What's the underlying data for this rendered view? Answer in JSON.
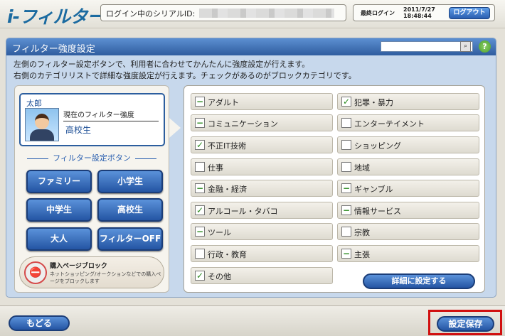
{
  "header": {
    "logo": "i-フィルター",
    "serial_label": "ログイン中のシリアルID:",
    "last_login_label": "最終ログイン",
    "last_login_date": "2011/7/27",
    "last_login_time": "18:48:44",
    "logout_label": "ログアウト"
  },
  "panel": {
    "title": "フィルター強度設定",
    "description_line1": "左側のフィルター設定ボタンで、利用者に合わせてかんたんに強度設定が行えます。",
    "description_line2": "右側のカテゴリリストで詳細な強度設定が行えます。チェックがあるのがブロックカテゴリです。"
  },
  "user": {
    "name": "太郎",
    "strength_label": "現在のフィルター強度",
    "strength_value": "高校生"
  },
  "presets": {
    "heading": "フィルター設定ボタン",
    "buttons": [
      "ファミリー",
      "小学生",
      "中学生",
      "高校生",
      "大人",
      "フィルターOFF"
    ]
  },
  "purchase_block": {
    "title": "購入ページブロック",
    "description": "ネットショッピング/オークションなどでの購入ページをブロックします"
  },
  "categories": [
    {
      "label": "アダルト",
      "state": "partial"
    },
    {
      "label": "犯罪・暴力",
      "state": "checked"
    },
    {
      "label": "コミュニケーション",
      "state": "partial"
    },
    {
      "label": "エンターテイメント",
      "state": "unchecked"
    },
    {
      "label": "不正IT技術",
      "state": "checked"
    },
    {
      "label": "ショッピング",
      "state": "unchecked"
    },
    {
      "label": "仕事",
      "state": "unchecked"
    },
    {
      "label": "地域",
      "state": "unchecked"
    },
    {
      "label": "金融・経済",
      "state": "partial"
    },
    {
      "label": "ギャンブル",
      "state": "partial"
    },
    {
      "label": "アルコール・タバコ",
      "state": "checked"
    },
    {
      "label": "情報サービス",
      "state": "partial"
    },
    {
      "label": "ツール",
      "state": "partial"
    },
    {
      "label": "宗教",
      "state": "unchecked"
    },
    {
      "label": "行政・教育",
      "state": "unchecked"
    },
    {
      "label": "主張",
      "state": "partial"
    },
    {
      "label": "その他",
      "state": "checked"
    }
  ],
  "detail_button": "詳細に設定する",
  "footer": {
    "back_label": "もどる",
    "save_label": "設定保存"
  },
  "icons": {
    "check": "✓",
    "partial": "−"
  },
  "colors": {
    "accent": "#2a5fb0",
    "highlight": "#d10f0f",
    "check": "#2c8b20"
  }
}
